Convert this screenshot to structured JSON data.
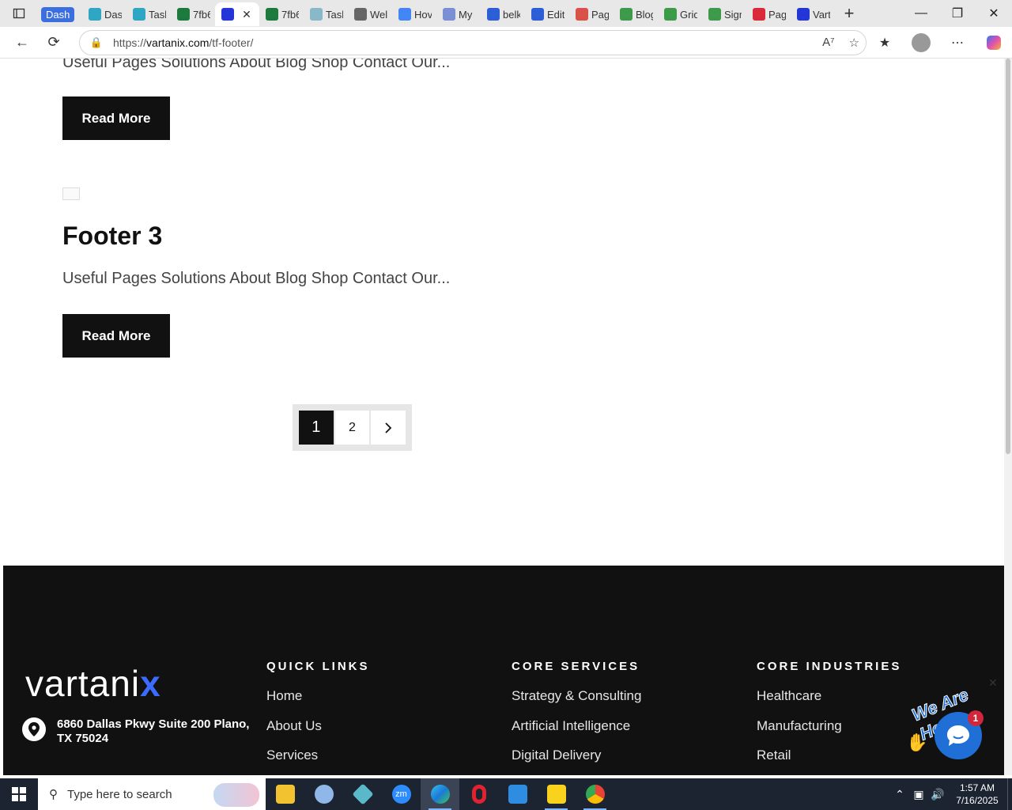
{
  "browser": {
    "tabs": [
      {
        "title": "Dash",
        "group": true,
        "color": "#3b6fe0"
      },
      {
        "title": "Dash",
        "color": "#2fa7c4"
      },
      {
        "title": "Task",
        "color": "#2fa7c4"
      },
      {
        "title": "7fb6",
        "color": "#1d7a3e"
      },
      {
        "title": "",
        "active": true,
        "color": "#2436d6"
      },
      {
        "title": "7fb6",
        "color": "#1d7a3e"
      },
      {
        "title": "Task",
        "color": "#8bb8c8"
      },
      {
        "title": "Wel",
        "color": "#666"
      },
      {
        "title": "Hov",
        "color": "#4285f4"
      },
      {
        "title": "My",
        "color": "#7b8fd4"
      },
      {
        "title": "belk",
        "color": "#2c5fd6"
      },
      {
        "title": "Edit",
        "color": "#2c5fd6"
      },
      {
        "title": "Pag",
        "color": "#d8524a"
      },
      {
        "title": "Blog",
        "color": "#3d9a4a"
      },
      {
        "title": "Grid",
        "color": "#3d9a4a"
      },
      {
        "title": "Sign",
        "color": "#3d9a4a"
      },
      {
        "title": "Pag",
        "color": "#d82a3a"
      },
      {
        "title": "Vart",
        "color": "#2436d6"
      }
    ],
    "url_prefix": "https://",
    "url_domain": "vartanix.com",
    "url_path": "/tf-footer/"
  },
  "posts": {
    "prev_excerpt": "Useful Pages Solutions About Blog Shop Contact Our...",
    "prev_read_more": "Read More",
    "title": "Footer 3",
    "excerpt": "Useful Pages Solutions About Blog Shop Contact Our...",
    "read_more": "Read More"
  },
  "pagination": {
    "current": "1",
    "page2": "2",
    "next_icon": "chevron-right-icon"
  },
  "footer": {
    "logo_text": "vartani",
    "logo_x": "x",
    "address": "6860 Dallas Pkwy Suite 200 Plano, TX 75024",
    "quick_links": {
      "heading": "QUICK LINKS",
      "items": [
        "Home",
        "About Us",
        "Services"
      ]
    },
    "core_services": {
      "heading": "CORE SERVICES",
      "items": [
        "Strategy & Consulting",
        "Artificial Intelligence",
        "Digital Delivery"
      ]
    },
    "core_industries": {
      "heading": "CORE INDUSTRIES",
      "items": [
        "Healthcare",
        "Manufacturing",
        "Retail"
      ]
    }
  },
  "chat": {
    "tagline": "We Are Here!",
    "badge": "1"
  },
  "taskbar": {
    "search_placeholder": "Type here to search",
    "time": "1:57 AM",
    "date": "7/16/2025"
  }
}
